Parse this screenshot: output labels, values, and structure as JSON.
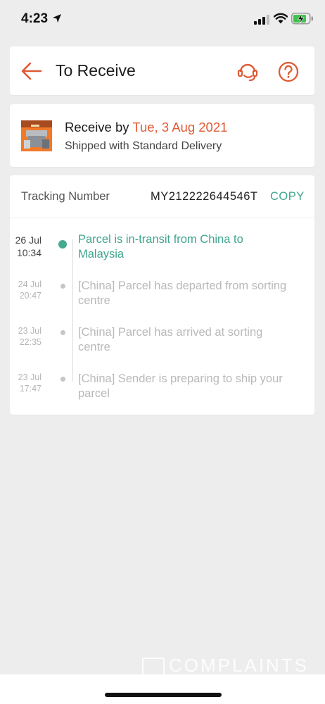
{
  "status_bar": {
    "time": "4:23"
  },
  "header": {
    "title": "To Receive"
  },
  "delivery": {
    "receive_prefix": "Receive by ",
    "receive_date": "Tue, 3 Aug 2021",
    "shipping_method": "Shipped with Standard Delivery"
  },
  "tracking": {
    "label": "Tracking Number",
    "number": "MY212222644546T",
    "copy_label": "COPY",
    "events": [
      {
        "day": "26 Jul",
        "time": "10:34",
        "text": "Parcel is in-transit from China to Malaysia"
      },
      {
        "day": "24 Jul",
        "time": "20:47",
        "text": "[China] Parcel has departed from sorting centre"
      },
      {
        "day": "23 Jul",
        "time": "22:35",
        "text": "[China] Parcel has arrived at  sorting centre"
      },
      {
        "day": "23 Jul",
        "time": "17:47",
        "text": "[China] Sender is preparing to ship your parcel"
      }
    ]
  },
  "watermark": "COMPLAINTS",
  "colors": {
    "accent": "#e05a35",
    "active_green": "#3fa58d",
    "background": "#ededed"
  },
  "icons": [
    "location-arrow-icon",
    "signal-icon",
    "wifi-icon",
    "battery-charging-icon",
    "back-arrow-icon",
    "customer-support-icon",
    "help-icon"
  ]
}
